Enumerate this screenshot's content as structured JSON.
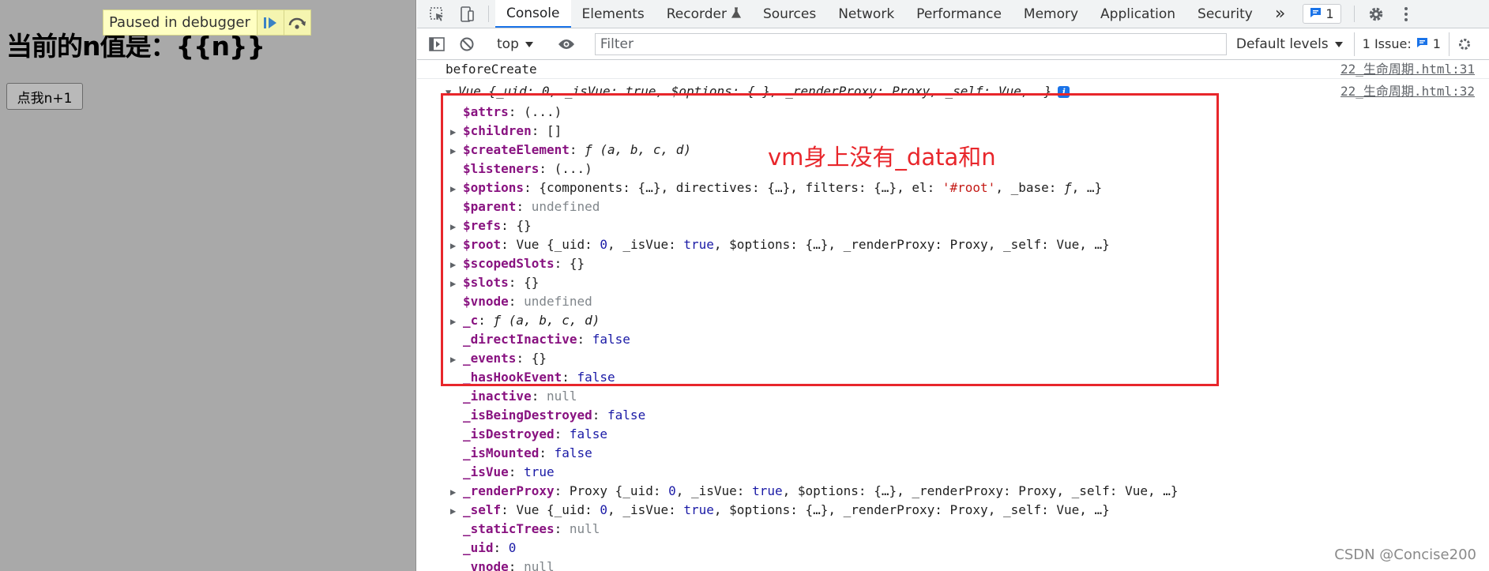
{
  "page": {
    "heading": "当前的n值是：{{n}}",
    "button_label": "点我n+1",
    "debugger_banner": "Paused in debugger",
    "resume_icon": "resume-icon",
    "step_over_icon": "step-over-icon"
  },
  "devtools": {
    "tabs": [
      {
        "label": "Console"
      },
      {
        "label": "Elements"
      },
      {
        "label": "Recorder"
      },
      {
        "label": "Sources"
      },
      {
        "label": "Network"
      },
      {
        "label": "Performance"
      },
      {
        "label": "Memory"
      },
      {
        "label": "Application"
      },
      {
        "label": "Security"
      }
    ],
    "more_tabs": "»",
    "message_count": "1",
    "context": "top",
    "filter_placeholder": "Filter",
    "levels": "Default levels",
    "issues_label": "1 Issue:",
    "issues_count": "1",
    "accent": "#1a73e8"
  },
  "console": {
    "before_create": {
      "text": "beforeCreate",
      "source": "22_生命周期.html:31"
    },
    "vue_row": {
      "summary_prefix": "Vue ",
      "summary": "{_uid: 0, _isVue: true, $options: {…}, _renderProxy: Proxy, _self: Vue, …}",
      "source": "22_生命周期.html:32"
    },
    "props": [
      {
        "key": "$attrs",
        "value": "(...)",
        "expandable": false,
        "type": "obj"
      },
      {
        "key": "$children",
        "value": "[]",
        "expandable": true,
        "type": "obj"
      },
      {
        "key": "$createElement",
        "value": "ƒ (a, b, c, d)",
        "expandable": true,
        "type": "fn"
      },
      {
        "key": "$listeners",
        "value": "(...)",
        "expandable": false,
        "type": "obj"
      },
      {
        "key": "$options",
        "value_parts": [
          {
            "t": "{components: {…}, directives: {…}, filters: {…}, el: ",
            "c": "obj"
          },
          {
            "t": "'#root'",
            "c": "str"
          },
          {
            "t": ", _base: ",
            "c": "obj"
          },
          {
            "t": "ƒ",
            "c": "fn"
          },
          {
            "t": ", …}",
            "c": "obj"
          }
        ],
        "expandable": true
      },
      {
        "key": "$parent",
        "value": "undefined",
        "expandable": false,
        "type": "undef"
      },
      {
        "key": "$refs",
        "value": "{}",
        "expandable": true,
        "type": "obj"
      },
      {
        "key": "$root",
        "value_parts": [
          {
            "t": "Vue {_uid: ",
            "c": "obj"
          },
          {
            "t": "0",
            "c": "num"
          },
          {
            "t": ", _isVue: ",
            "c": "obj"
          },
          {
            "t": "true",
            "c": "bool"
          },
          {
            "t": ", $options: {…}, _renderProxy: Proxy, _self: Vue, …}",
            "c": "obj"
          }
        ],
        "expandable": true
      },
      {
        "key": "$scopedSlots",
        "value": "{}",
        "expandable": true,
        "type": "obj"
      },
      {
        "key": "$slots",
        "value": "{}",
        "expandable": true,
        "type": "obj"
      },
      {
        "key": "$vnode",
        "value": "undefined",
        "expandable": false,
        "type": "undef"
      },
      {
        "key": "_c",
        "value": "ƒ (a, b, c, d)",
        "expandable": true,
        "type": "fn"
      },
      {
        "key": "_directInactive",
        "value": "false",
        "expandable": false,
        "type": "bool"
      },
      {
        "key": "_events",
        "value": "{}",
        "expandable": true,
        "type": "obj"
      },
      {
        "key": "_hasHookEvent",
        "value": "false",
        "expandable": false,
        "type": "bool"
      },
      {
        "key": "_inactive",
        "value": "null",
        "expandable": false,
        "type": "undef"
      },
      {
        "key": "_isBeingDestroyed",
        "value": "false",
        "expandable": false,
        "type": "bool"
      },
      {
        "key": "_isDestroyed",
        "value": "false",
        "expandable": false,
        "type": "bool"
      },
      {
        "key": "_isMounted",
        "value": "false",
        "expandable": false,
        "type": "bool"
      },
      {
        "key": "_isVue",
        "value": "true",
        "expandable": false,
        "type": "bool"
      },
      {
        "key": "_renderProxy",
        "value_parts": [
          {
            "t": "Proxy {_uid: ",
            "c": "obj"
          },
          {
            "t": "0",
            "c": "num"
          },
          {
            "t": ", _isVue: ",
            "c": "obj"
          },
          {
            "t": "true",
            "c": "bool"
          },
          {
            "t": ", $options: {…}, _renderProxy: Proxy, _self: Vue, …}",
            "c": "obj"
          }
        ],
        "expandable": true
      },
      {
        "key": "_self",
        "value_parts": [
          {
            "t": "Vue {_uid: ",
            "c": "obj"
          },
          {
            "t": "0",
            "c": "num"
          },
          {
            "t": ", _isVue: ",
            "c": "obj"
          },
          {
            "t": "true",
            "c": "bool"
          },
          {
            "t": ", $options: {…}, _renderProxy: Proxy, _self: Vue, …}",
            "c": "obj"
          }
        ],
        "expandable": true
      },
      {
        "key": "_staticTrees",
        "value": "null",
        "expandable": false,
        "type": "undef"
      },
      {
        "key": "_uid",
        "value": "0",
        "expandable": false,
        "type": "num"
      },
      {
        "key": "_vnode",
        "value": "null",
        "expandable": false,
        "type": "undef"
      }
    ]
  },
  "annotation": {
    "text": "vm身上没有_data和n",
    "color": "#e8262b"
  },
  "watermark": "CSDN @Concise200"
}
